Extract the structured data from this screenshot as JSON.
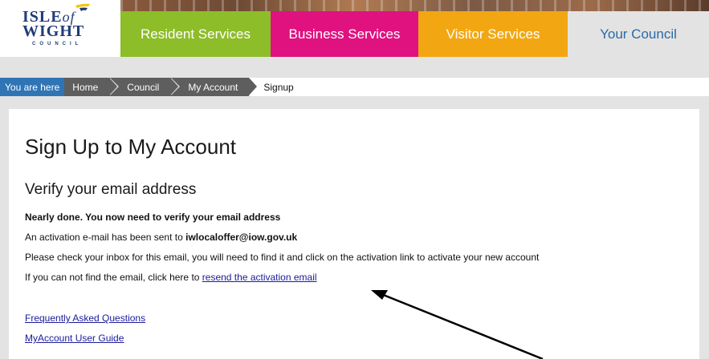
{
  "logo": {
    "line1_a": "ISLE",
    "line1_b": "of",
    "line2": "WIGHT",
    "line3": "COUNCIL"
  },
  "nav": {
    "tabs": [
      {
        "label": "Resident Services",
        "color": "#8dbd28"
      },
      {
        "label": "Business Services",
        "color": "#e0127f"
      },
      {
        "label": "Visitor Services",
        "color": "#f2a712"
      },
      {
        "label": "Your Council",
        "color": "#2c6aa6",
        "active": true
      }
    ]
  },
  "breadcrumb": {
    "prefix": "You are here",
    "items": [
      "Home",
      "Council",
      "My Account"
    ],
    "current": "Signup"
  },
  "page": {
    "title": "Sign Up to My Account",
    "subtitle": "Verify your email address",
    "nearly_done": "Nearly done. You now need to verify your email address",
    "sent_prefix": "An activation e-mail has been sent to ",
    "email": "iwlocaloffer@iow.gov.uk",
    "check_inbox": "Please check your inbox for this email, you will need to find it and click on the activation link to activate your new account",
    "not_found_prefix": "If you can not find the email, click here to ",
    "resend_link": "resend the activation email",
    "faq_link": "Frequently Asked Questions",
    "guide_link": "MyAccount User Guide"
  },
  "colors": {
    "breadcrumb_prefix_bg": "#2f75b5",
    "breadcrumb_item_bg": "#5e5e5e",
    "link": "#1a1a9c"
  }
}
